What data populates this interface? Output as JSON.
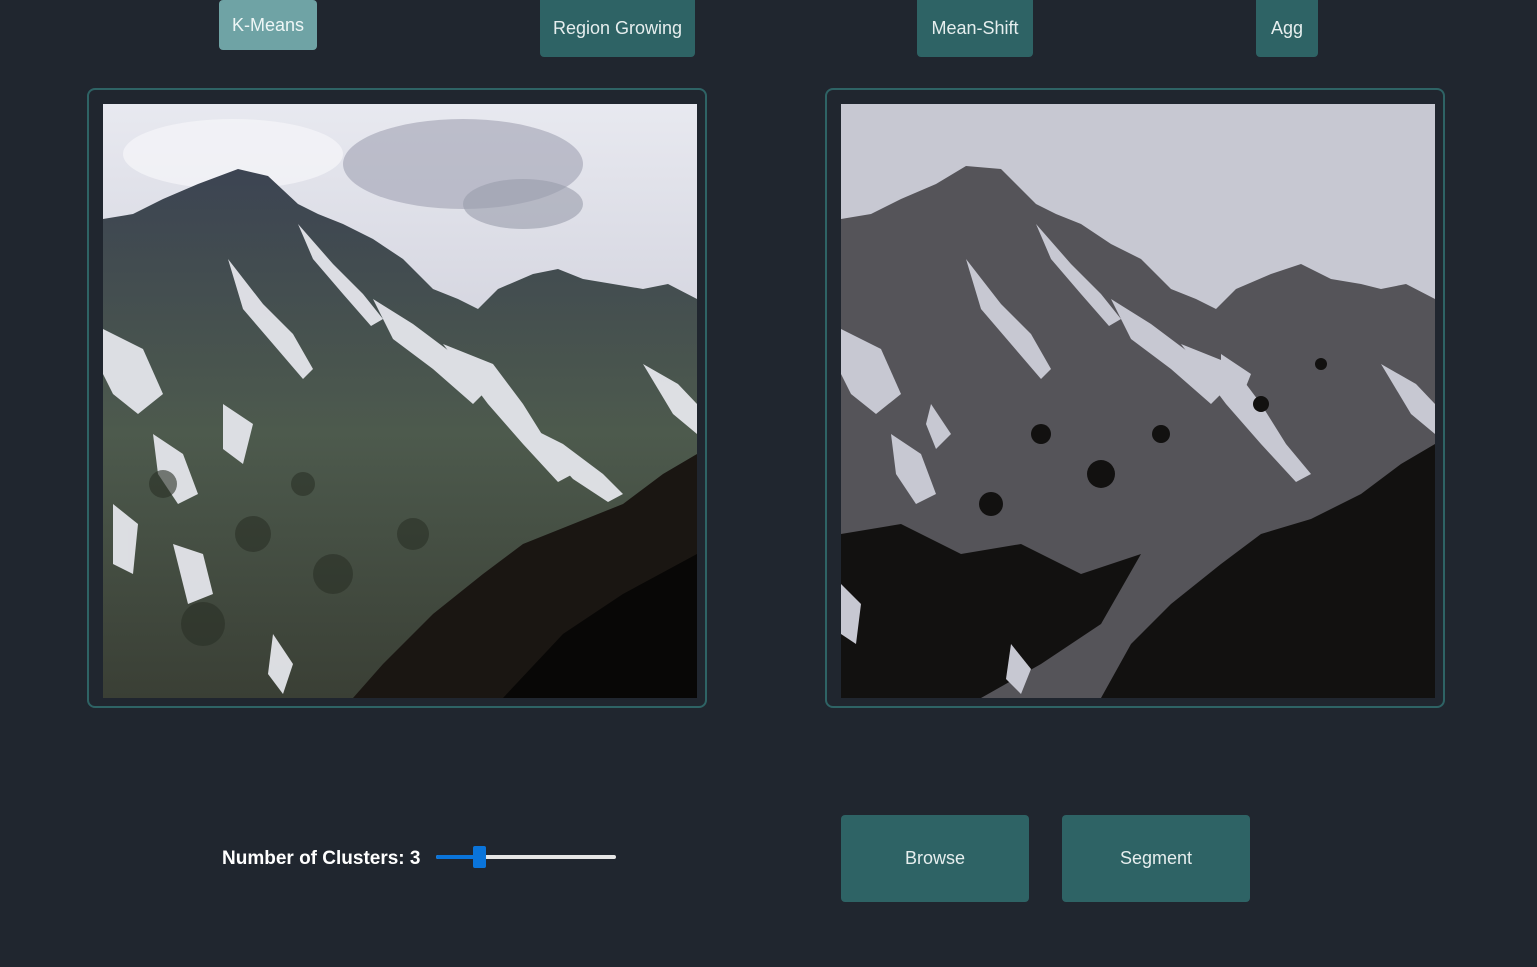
{
  "tabs": [
    {
      "label": "K-Means",
      "active": true
    },
    {
      "label": "Region Growing",
      "active": false
    },
    {
      "label": "Mean-Shift",
      "active": false
    },
    {
      "label": "Agg",
      "active": false
    }
  ],
  "panels": {
    "input_image": "mountain-photo",
    "output_image": "segmented-mountain"
  },
  "clusters": {
    "label": "Number of Clusters: 3",
    "value": 3,
    "slider_fraction": 0.24
  },
  "actions": {
    "browse_label": "Browse",
    "segment_label": "Segment"
  },
  "colors": {
    "background": "#20262f",
    "button": "#2e6365",
    "button_active": "#6fa3a5",
    "slider": "#0a74da"
  }
}
